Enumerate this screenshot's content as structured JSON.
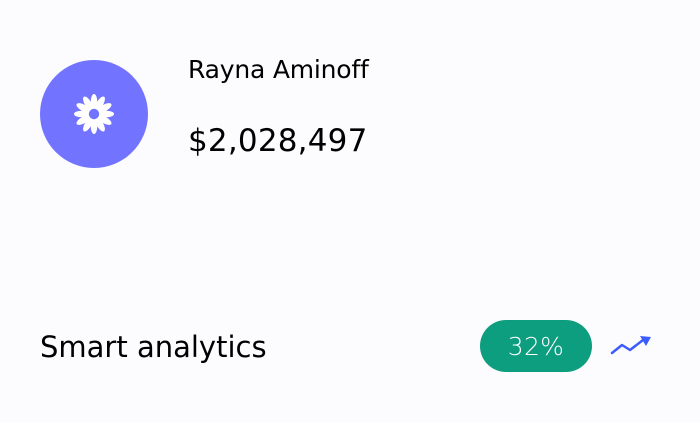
{
  "profile": {
    "name": "Rayna Aminoff",
    "amount": "$2,028,497",
    "avatar_icon": "flower-icon"
  },
  "analytics": {
    "label": "Smart analytics",
    "percent": "32%",
    "trend_icon": "trending-up-icon"
  },
  "colors": {
    "background": "#fcfbfd",
    "avatar": "#7274ff",
    "pill": "#0d9e80",
    "trend": "#3b5cff"
  }
}
